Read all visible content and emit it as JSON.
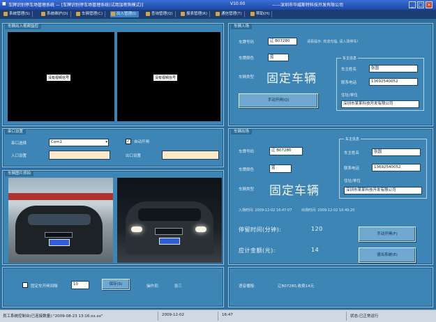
{
  "titlebar": {
    "title": "车牌识别停车场管理系统 — [车牌识别停车场管理系统(试用加密狗模式)]",
    "version": "V10.00",
    "company": "——深圳市华威斯特科技开发有限公司",
    "minimize": "_",
    "maximize": "□",
    "close": "×"
  },
  "menu": [
    {
      "label": "系统管理(S)"
    },
    {
      "label": "系统维护(D)"
    },
    {
      "label": "车辆管理(C)"
    },
    {
      "label": "出入管理(I)"
    },
    {
      "label": "查询管理(Q)"
    },
    {
      "label": "报表管理(R)"
    },
    {
      "label": "通信管理(T)"
    },
    {
      "label": "帮助(H)"
    }
  ],
  "video_panel": {
    "title": "车辆出入视频监控",
    "left_label": "没有视频信号",
    "right_label": "没有视频信号"
  },
  "entry_panel": {
    "title": "车辆入场",
    "plate_label": "车牌号码",
    "plate_value": "辽 B07280",
    "hint": "请看提示: 欢迎光临, 请入场停车!",
    "color_label": "车牌颜色",
    "color_value": "蓝",
    "type_label": "车辆类型",
    "type_value": "固定车辆",
    "button": "手动开闸(Q)",
    "owner_group": "车主信息",
    "owner_name_label": "车主姓名",
    "owner_name_value": "张国",
    "phone_label": "联系电话",
    "phone_value": "13692540052",
    "addr_label": "住址/单位",
    "addr_value": "深圳市某某科技开发有限公司"
  },
  "port_panel": {
    "title": "串口设置",
    "port_label": "串口选择",
    "port_value": "Com1",
    "checkbox_label": "自动开闸",
    "entry_cam_label": "入口设置",
    "exit_cam_label": "出口设置"
  },
  "capture_panel": {
    "title": "车辆图片抓拍"
  },
  "exit_panel": {
    "title": "车辆出场",
    "plate_label": "车牌号码",
    "plate_value": "辽 B07280",
    "color_label": "车牌颜色",
    "color_value": "蓝",
    "type_label": "车辆类型",
    "type_value": "固定车辆",
    "entry_time": "入场时间: 2009-12-02 16:47:07",
    "exit_time": "出场时间: 2009-12-02 16:49:20",
    "stay_label": "停留时间(分钟):",
    "stay_value": "120",
    "fee_label": "应计金额(元):",
    "fee_value": "14",
    "btn1": "手动开闸(F)",
    "btn2": "退出系统(E)",
    "owner_group": "车主信息",
    "owner_name_label": "车主姓名",
    "owner_name_value": "张国",
    "phone_label": "联系电话",
    "phone_value": "13692540052",
    "addr_label": "住址/单位",
    "addr_value": "深圳市某某科技开发有限公司"
  },
  "bottom_left": {
    "checkbox_label": "固定车开闸间隔",
    "interval_value": "10",
    "button": "保存(S)",
    "operator_label": "操作员:",
    "operator_value": "张三"
  },
  "bottom_right": {
    "text": "语音播报:",
    "value": "辽B07280,收费14元"
  },
  "statusbar": {
    "s1": "员工系统控制台(已连接数量):\"2009-08-23 13:16:xx.xx\"",
    "s2": "2009-12-02",
    "s3": "16:47",
    "s4": "状态:已正常运行"
  }
}
